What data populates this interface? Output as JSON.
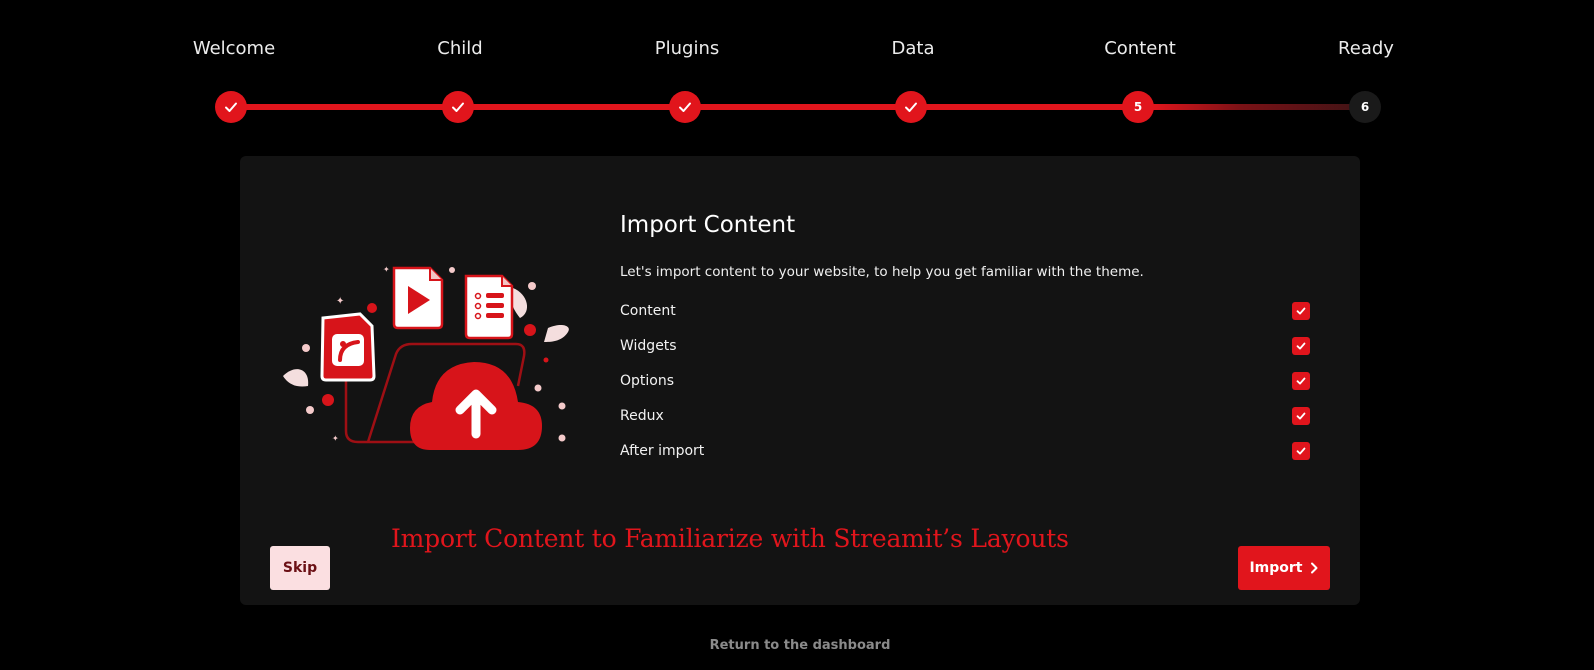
{
  "colors": {
    "accent": "#e1151c",
    "background": "#000000",
    "card": "#131313",
    "skip_bg": "#fbdfe1",
    "pending_dot": "#1a1a1a"
  },
  "steps": [
    {
      "label": "Welcome",
      "state": "done",
      "icon": "check-icon"
    },
    {
      "label": "Child",
      "state": "done",
      "icon": "check-icon"
    },
    {
      "label": "Plugins",
      "state": "done",
      "icon": "check-icon"
    },
    {
      "label": "Data",
      "state": "done",
      "icon": "check-icon"
    },
    {
      "label": "Content",
      "state": "current",
      "number": "5"
    },
    {
      "label": "Ready",
      "state": "pending",
      "number": "6"
    }
  ],
  "card": {
    "title": "Import Content",
    "description": "Let's import content to your website, to help you get familiar with the theme.",
    "options": [
      {
        "label": "Content",
        "checked": true
      },
      {
        "label": "Widgets",
        "checked": true
      },
      {
        "label": "Options",
        "checked": true
      },
      {
        "label": "Redux",
        "checked": true
      },
      {
        "label": "After import",
        "checked": true
      }
    ],
    "banner": "Import Content to Familiarize with Streamit’s Layouts",
    "illustration_icons": [
      "image-file-icon",
      "play-file-icon",
      "list-file-icon",
      "folder-icon",
      "cloud-upload-icon"
    ]
  },
  "buttons": {
    "skip": "Skip",
    "import": "Import"
  },
  "footer": {
    "return_link": "Return to the dashboard"
  }
}
